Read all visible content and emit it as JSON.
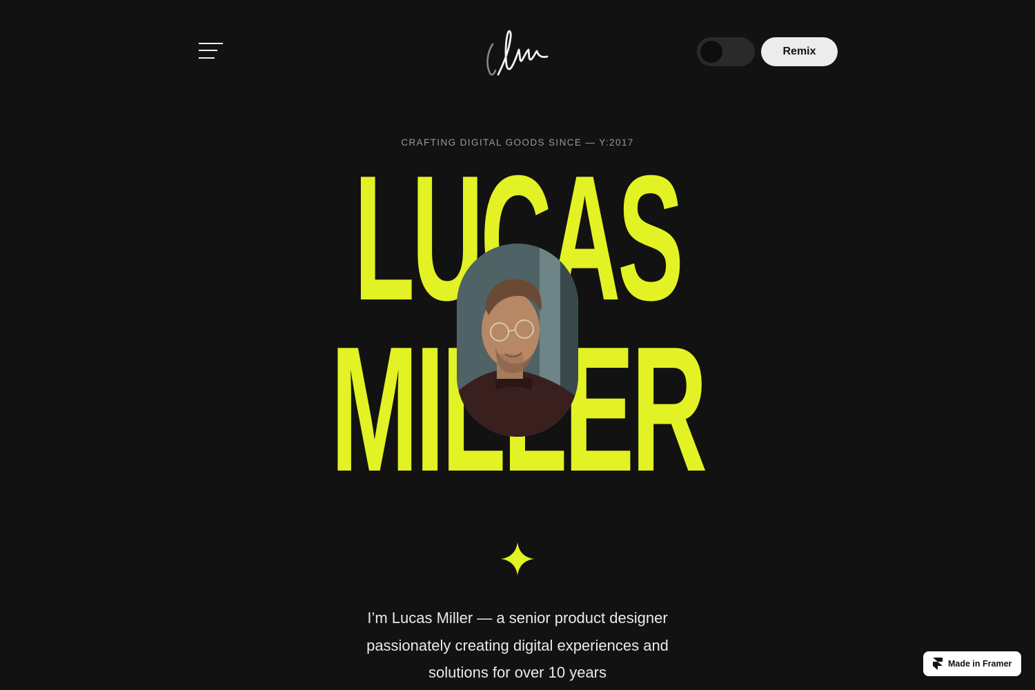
{
  "header": {
    "menu_icon": "hamburger-menu-icon",
    "logo_icon": "signature-logo-icon",
    "theme_toggle": {
      "state": "dark"
    },
    "remix_label": "Remix"
  },
  "hero": {
    "eyebrow": "CRAFTING DIGITAL GOODS SINCE — Y:2017",
    "first_name": "LUCAS",
    "last_name": "MILLER",
    "portrait_icon": "portrait-photo",
    "sparkle_icon": "sparkle-star-icon"
  },
  "intro": {
    "lines": [
      "I’m Lucas Miller — a senior product designer",
      "passionately creating digital experiences and",
      "solutions for over 10 years"
    ]
  },
  "badge": {
    "label": "Made in Framer",
    "icon": "framer-logo-icon"
  },
  "colors": {
    "accent": "#e2f224",
    "background": "#121212",
    "text": "#eaeaea"
  }
}
